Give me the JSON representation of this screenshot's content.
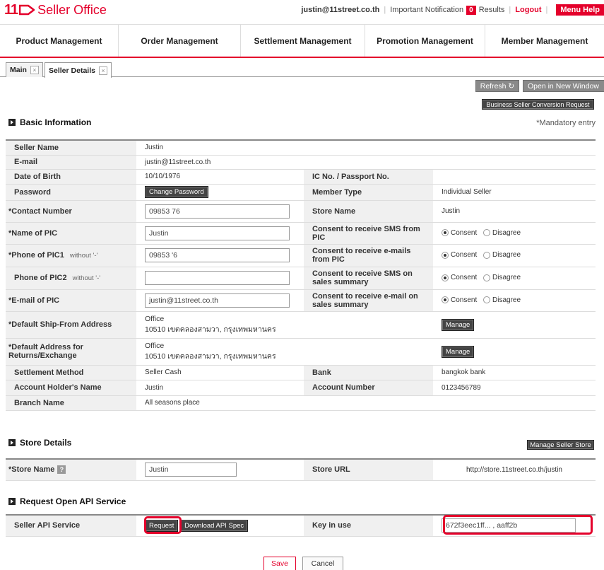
{
  "header": {
    "logo_num": "11",
    "logo_text": "Seller Office",
    "email": "justin@11street.co.th",
    "notification": "Important Notification",
    "notification_count": "0",
    "results": "Results",
    "logout": "Logout",
    "menu_help": "Menu Help",
    "brand_color": "#e4002b"
  },
  "nav": [
    "Product Management",
    "Order Management",
    "Settlement Management",
    "Promotion Management",
    "Member Management"
  ],
  "tabs": [
    {
      "label": "Main",
      "close": "×"
    },
    {
      "label": "Seller Details",
      "close": "×"
    }
  ],
  "toolbar": {
    "refresh": "Refresh ↻",
    "open_new_window": "Open in New Window",
    "business_conversion": "Business Seller Conversion Request"
  },
  "basic": {
    "title": "Basic Information",
    "mandatory": "*Mandatory entry",
    "seller_name_label": "Seller Name",
    "seller_name": "Justin",
    "email_label": "E-mail",
    "email": "justin@11street.co.th",
    "dob_label": "Date of Birth",
    "dob": "10/10/1976",
    "ic_label": "IC No. / Passport No.",
    "ic": "",
    "password_label": "Password",
    "change_password": "Change Password",
    "member_type_label": "Member Type",
    "member_type": "Individual Seller",
    "contact_label": "*Contact Number",
    "contact": "09853    76",
    "store_name_label": "Store Name",
    "store_name": "Justin",
    "pic_name_label": "*Name of PIC",
    "pic_name": "Justin",
    "sms_pic_label": "Consent to receive SMS from PIC",
    "pic_phone1_label": "*Phone of PIC1",
    "pic_phone1_sub": "without '-'",
    "pic_phone1": "09853     '6",
    "email_pic_consent_label": "Consent to receive e-mails from PIC",
    "pic_phone2_label": "Phone of PIC2",
    "pic_phone2_sub": "without '-'",
    "pic_phone2": "",
    "sms_sales_label": "Consent to receive SMS on sales summary",
    "pic_email_label": "*E-mail of PIC",
    "pic_email": "justin@11street.co.th",
    "email_sales_label": "Consent to receive e-mail on sales summary",
    "consent": "Consent",
    "disagree": "Disagree",
    "ship_label": "*Default Ship-From Address",
    "ship_line1": "Office",
    "ship_line2": "10510 เขตคลองสามวา, กรุงเทพมหานคร",
    "return_label": "*Default Address for Returns/Exchange",
    "return_line1": "Office",
    "return_line2": "10510 เขตคลองสามวา, กรุงเทพมหานคร",
    "manage": "Manage",
    "settlement_label": "Settlement Method",
    "settlement": "Seller Cash",
    "bank_label": "Bank",
    "bank": "bangkok bank",
    "holder_label": "Account Holder's Name",
    "holder": "Justin",
    "account_no_label": "Account Number",
    "account_no": "0123456789",
    "branch_label": "Branch Name",
    "branch": "All seasons place"
  },
  "store": {
    "title": "Store Details",
    "manage_store": "Manage Seller Store",
    "store_name_label": "*Store Name",
    "store_name_help": "?",
    "store_name": "Justin",
    "url_label": "Store URL",
    "url": "http://store.11street.co.th/justin"
  },
  "api": {
    "title": "Request Open API Service",
    "service_label": "Seller API Service",
    "request": "Request",
    "download": "Download API Spec",
    "key_label": "Key in use",
    "key": "672f3eec1ff...   ,      aaff2b"
  },
  "footer": {
    "save": "Save",
    "cancel": "Cancel"
  }
}
